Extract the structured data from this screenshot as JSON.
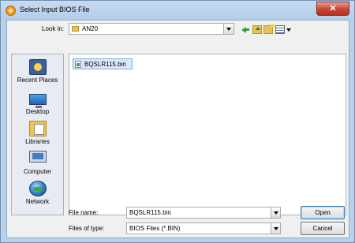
{
  "window": {
    "title": "Select Input BIOS File",
    "close_label": "✕"
  },
  "toolbar": {
    "look_in_label": "Look in:",
    "look_in_value": "AN20",
    "icons": [
      "back-arrow-icon",
      "up-folder-icon",
      "new-folder-icon",
      "view-menu-icon"
    ]
  },
  "places": [
    {
      "label": "Recent Places",
      "icon": "recent-places-icon"
    },
    {
      "label": "Desktop",
      "icon": "desktop-icon"
    },
    {
      "label": "Libraries",
      "icon": "libraries-icon"
    },
    {
      "label": "Computer",
      "icon": "computer-icon"
    },
    {
      "label": "Network",
      "icon": "network-icon"
    }
  ],
  "files": [
    {
      "name": "BQSLR115.bin",
      "icon": "bin-file-icon",
      "selected": true
    }
  ],
  "form": {
    "file_name_label": "File name:",
    "file_name_value": "BQSLR115.bin",
    "file_type_label": "Files of type:",
    "file_type_value": "BIOS Files (*.BIN)"
  },
  "buttons": {
    "open": "Open",
    "cancel": "Cancel"
  }
}
